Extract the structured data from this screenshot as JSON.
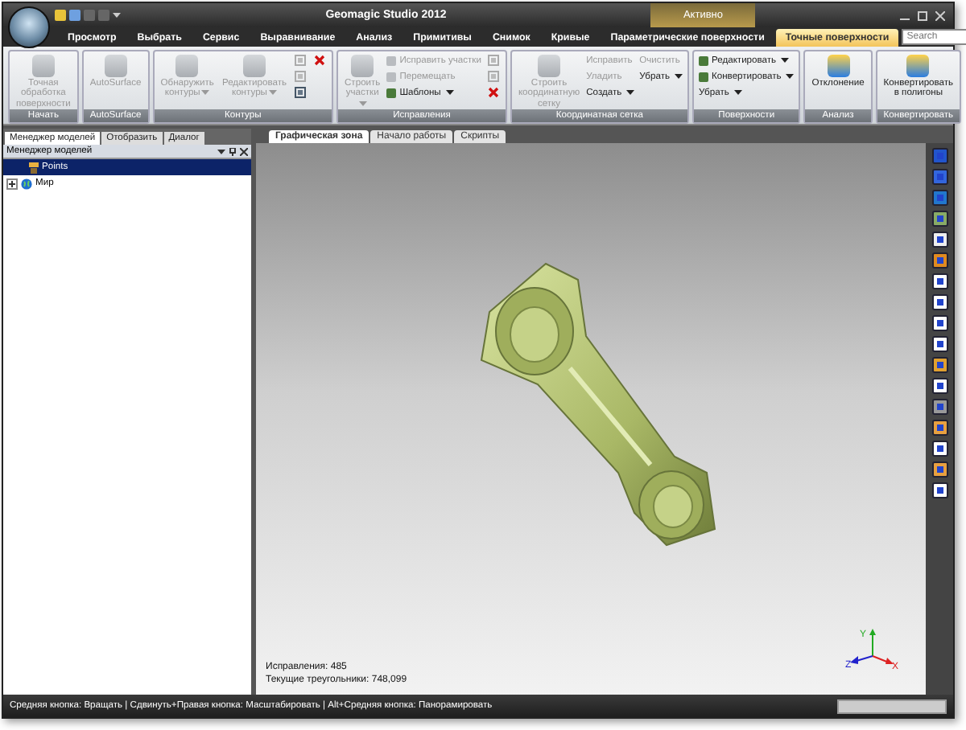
{
  "window": {
    "title": "Geomagic Studio 2012",
    "context_label": "Активно"
  },
  "menu_tabs": [
    {
      "label": "Просмотр",
      "selected": false
    },
    {
      "label": "Выбрать",
      "selected": false
    },
    {
      "label": "Сервис",
      "selected": false
    },
    {
      "label": "Выравнивание",
      "selected": false
    },
    {
      "label": "Анализ",
      "selected": false
    },
    {
      "label": "Примитивы",
      "selected": false
    },
    {
      "label": "Снимок",
      "selected": false
    },
    {
      "label": "Кривые",
      "selected": false
    },
    {
      "label": "Параметрические поверхности",
      "selected": false
    },
    {
      "label": "Точные поверхности",
      "selected": true
    }
  ],
  "search": {
    "placeholder": "Search"
  },
  "ribbon_groups": [
    {
      "label": "Начать",
      "items": [
        {
          "kind": "large",
          "label": "Точная обработка поверхности",
          "disabled": true,
          "dropdown": false
        }
      ]
    },
    {
      "label": "AutoSurface",
      "items": [
        {
          "kind": "large",
          "label": "AutoSurface",
          "disabled": true,
          "dropdown": false
        }
      ]
    },
    {
      "label": "Контуры",
      "items": [
        {
          "kind": "large",
          "label": "Обнаружить контуры",
          "disabled": true,
          "dropdown": true
        },
        {
          "kind": "large",
          "label": "Редактировать контуры",
          "disabled": true,
          "dropdown": true
        },
        {
          "kind": "icon",
          "disabled": true
        },
        {
          "kind": "icon",
          "disabled": true
        },
        {
          "kind": "icon",
          "disabled": false
        },
        {
          "kind": "delete",
          "disabled": false
        }
      ]
    },
    {
      "label": "Исправления",
      "items": [
        {
          "kind": "large",
          "label": "Строить участки",
          "disabled": true,
          "dropdown": true
        },
        {
          "kind": "small",
          "label": "Исправить участки",
          "disabled": true,
          "dropdown": false,
          "has_icon": true
        },
        {
          "kind": "small",
          "label": "Перемещать",
          "disabled": true,
          "dropdown": false,
          "has_icon": true
        },
        {
          "kind": "small",
          "label": "Шаблоны",
          "disabled": false,
          "dropdown": true,
          "has_icon": true
        },
        {
          "kind": "icon",
          "disabled": true
        },
        {
          "kind": "icon",
          "disabled": true
        },
        {
          "kind": "delete",
          "disabled": false
        }
      ]
    },
    {
      "label": "Координатная сетка",
      "items": [
        {
          "kind": "large",
          "label": "Строить координатную сетку",
          "disabled": true,
          "dropdown": false
        },
        {
          "kind": "small",
          "label": "Исправить",
          "disabled": true,
          "dropdown": false,
          "has_icon": false
        },
        {
          "kind": "small",
          "label": "Уладить",
          "disabled": true,
          "dropdown": false,
          "has_icon": false
        },
        {
          "kind": "small",
          "label": "Создать",
          "disabled": false,
          "dropdown": true,
          "has_icon": false
        },
        {
          "kind": "small",
          "label": "Очистить",
          "disabled": true,
          "dropdown": false,
          "has_icon": false
        },
        {
          "kind": "small",
          "label": "Убрать",
          "disabled": false,
          "dropdown": true,
          "has_icon": false
        }
      ]
    },
    {
      "label": "Поверхности",
      "items": [
        {
          "kind": "small",
          "label": "Редактировать",
          "disabled": false,
          "dropdown": true,
          "has_icon": true
        },
        {
          "kind": "small",
          "label": "Конвертировать",
          "disabled": false,
          "dropdown": true,
          "has_icon": true
        },
        {
          "kind": "small",
          "label": "Убрать",
          "disabled": false,
          "dropdown": true,
          "has_icon": false
        }
      ]
    },
    {
      "label": "Анализ",
      "items": [
        {
          "kind": "large",
          "label": "Отклонение",
          "disabled": false,
          "dropdown": false
        }
      ]
    },
    {
      "label": "Конвертировать",
      "items": [
        {
          "kind": "large",
          "label": "Конвертировать в полигоны",
          "disabled": false,
          "dropdown": false
        }
      ]
    }
  ],
  "panel_tabs": [
    {
      "label": "Менеджер моделей",
      "selected": true
    },
    {
      "label": "Отобразить",
      "selected": false
    },
    {
      "label": "Диалог",
      "selected": false
    }
  ],
  "model_manager": {
    "title": "Менеджер моделей",
    "tree": [
      {
        "label": "Points",
        "selected": true
      },
      {
        "label": "Мир",
        "selected": false,
        "expanded": false,
        "expandable": true
      }
    ]
  },
  "doc_tabs": [
    {
      "label": "Графическая зона",
      "selected": true
    },
    {
      "label": "Начало работы",
      "selected": false
    },
    {
      "label": "Скрипты",
      "selected": false
    }
  ],
  "viewport": {
    "stats": [
      "Исправления: 485",
      "Текущие треугольники: 748,099"
    ],
    "axis_labels": [
      "Y",
      "Z",
      "X"
    ]
  },
  "status_bar": {
    "text": "Средняя кнопка: Вращать | Сдвинуть+Правая кнопка: Масштабировать | Alt+Средняя кнопка: Панорамировать"
  }
}
